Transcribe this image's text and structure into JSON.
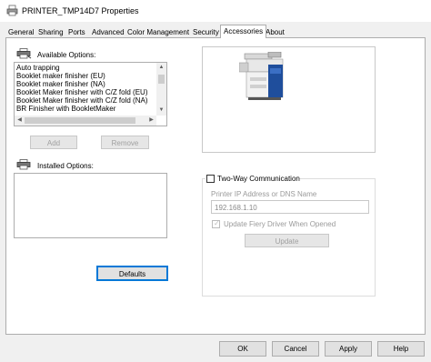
{
  "window": {
    "title": "PRINTER_TMP14D7 Properties",
    "icon": "printer-icon"
  },
  "tabs": [
    {
      "label": "General"
    },
    {
      "label": "Sharing"
    },
    {
      "label": "Ports"
    },
    {
      "label": "Advanced"
    },
    {
      "label": "Color Management"
    },
    {
      "label": "Security"
    },
    {
      "label": "Accessories",
      "active": true
    },
    {
      "label": "About"
    }
  ],
  "available": {
    "label": "Available Options:",
    "icon": "printer-options-icon",
    "items": [
      "Auto trapping",
      "Booklet maker finisher (EU)",
      "Booklet maker finisher (NA)",
      "Booklet Maker finisher with C/Z fold (EU)",
      "Booklet Maker finisher with C/Z fold (NA)",
      "BR Finisher with BookletMaker"
    ],
    "add_label": "Add",
    "remove_label": "Remove"
  },
  "installed": {
    "label": "Installed Options:",
    "icon": "printer-installed-icon",
    "items": [],
    "defaults_label": "Defaults"
  },
  "preview": {
    "icon": "copier-machine-icon",
    "accent": "#1f4e9c"
  },
  "two_way": {
    "checkbox_label": "Two-Way Communication",
    "checked": false,
    "ip_label": "Printer IP Address or DNS Name",
    "ip_value": "192.168.1.10",
    "update_driver_label": "Update Fiery Driver When Opened",
    "update_driver_checked": true,
    "update_button": "Update"
  },
  "footer": {
    "ok": "OK",
    "cancel": "Cancel",
    "apply": "Apply",
    "help": "Help"
  },
  "colors": {
    "primary_border": "#0078d7",
    "window_bg": "#f0f0f0",
    "panel_bg": "#ffffff"
  }
}
